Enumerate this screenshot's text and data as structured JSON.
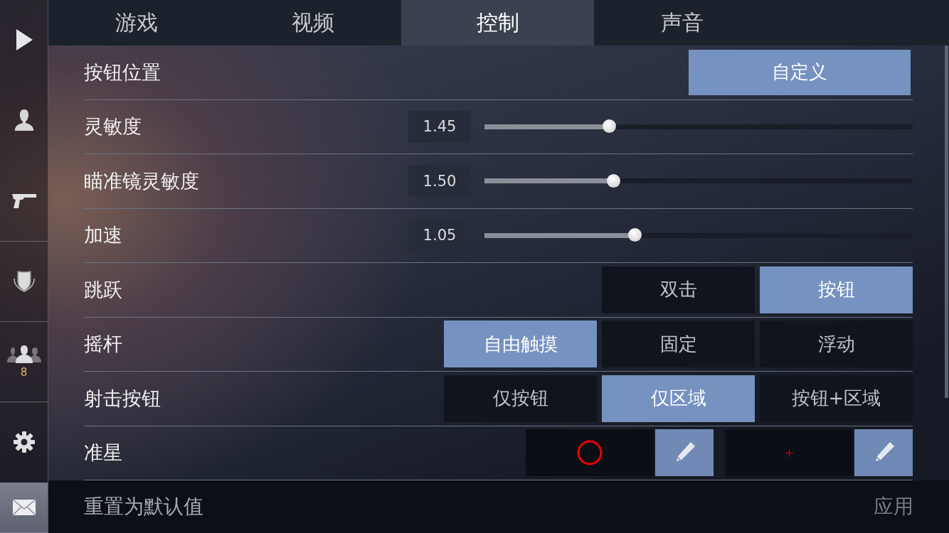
{
  "sidebar": {
    "items": [
      {
        "kind": "play",
        "selected": false
      },
      {
        "kind": "profile",
        "selected": false
      },
      {
        "kind": "pistol",
        "selected": false
      },
      {
        "kind": "shield",
        "selected": false
      },
      {
        "kind": "friends",
        "selected": false,
        "badge": "8"
      },
      {
        "kind": "settings",
        "selected": false
      },
      {
        "kind": "mail",
        "selected": true
      }
    ]
  },
  "tabs": [
    {
      "label": "游戏",
      "selected": false
    },
    {
      "label": "视频",
      "selected": false
    },
    {
      "label": "控制",
      "selected": true
    },
    {
      "label": "声音",
      "selected": false
    }
  ],
  "rows": [
    {
      "kind": "button",
      "label": "按钮位置",
      "options": [
        {
          "label": "自定义",
          "selected": true
        }
      ]
    },
    {
      "kind": "slider",
      "label": "灵敏度",
      "value": "1.45",
      "level": 0.29
    },
    {
      "kind": "slider",
      "label": "瞄准镜灵敏度",
      "value": "1.50",
      "level": 0.3
    },
    {
      "kind": "slider",
      "label": "加速",
      "value": "1.05",
      "level": 0.35
    },
    {
      "kind": "options",
      "label": "跳跃",
      "options": [
        {
          "label": "双击",
          "selected": false
        },
        {
          "label": "按钮",
          "selected": true
        }
      ]
    },
    {
      "kind": "options",
      "label": "摇杆",
      "options": [
        {
          "label": "自由触摸",
          "selected": true
        },
        {
          "label": "固定",
          "selected": false
        },
        {
          "label": "浮动",
          "selected": false
        }
      ]
    },
    {
      "kind": "options",
      "label": "射击按钮",
      "options": [
        {
          "label": "仅按钮",
          "selected": false
        },
        {
          "label": "仅区域",
          "selected": true
        },
        {
          "label": "按钮+区域",
          "selected": false
        }
      ]
    },
    {
      "kind": "crosshair",
      "label": "准星",
      "crosshairs": [
        {
          "kind": "circle"
        },
        {
          "kind": "cross"
        }
      ]
    }
  ],
  "footer": {
    "reset": "重置为默认值",
    "apply": "应用"
  }
}
